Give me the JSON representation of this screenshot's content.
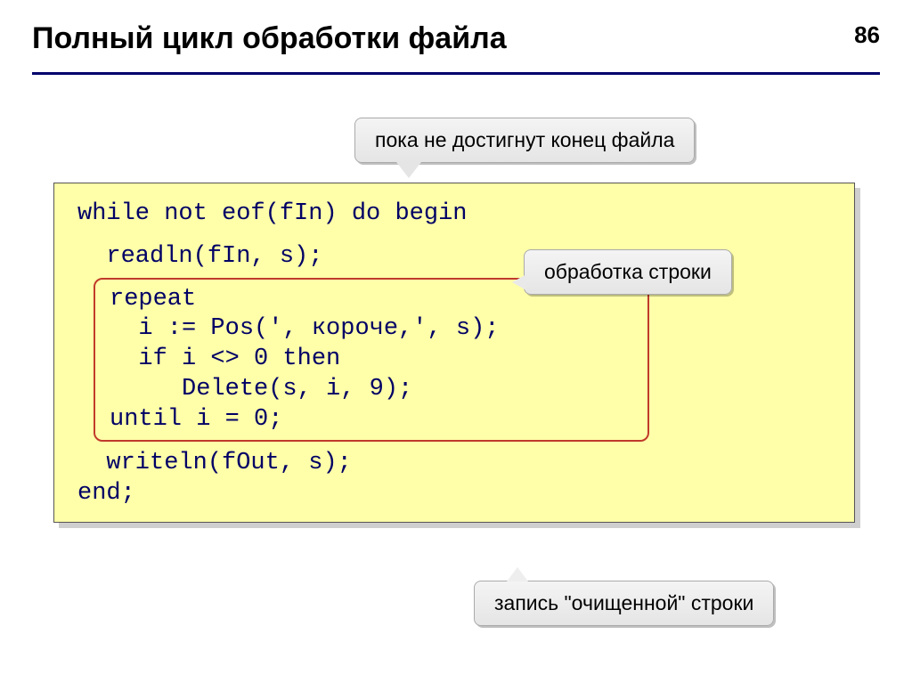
{
  "page_number": "86",
  "title": "Полный цикл обработки файла",
  "callouts": {
    "eof": "пока не достигнут конец файла",
    "process": "обработка строки",
    "write": "запись \"очищенной\"\nстроки"
  },
  "code": {
    "line1": "while not eof(fIn) do begin",
    "line2": "  readln(fIn, s);",
    "inner1": "repeat",
    "inner2": "  i := Pos(', короче,', s);",
    "inner3": "  if i <> 0 then",
    "inner4": "     Delete(s, i, 9);",
    "inner5": "until i = 0;",
    "line3": "  writeln(fOut, s);",
    "line4": "end;"
  }
}
